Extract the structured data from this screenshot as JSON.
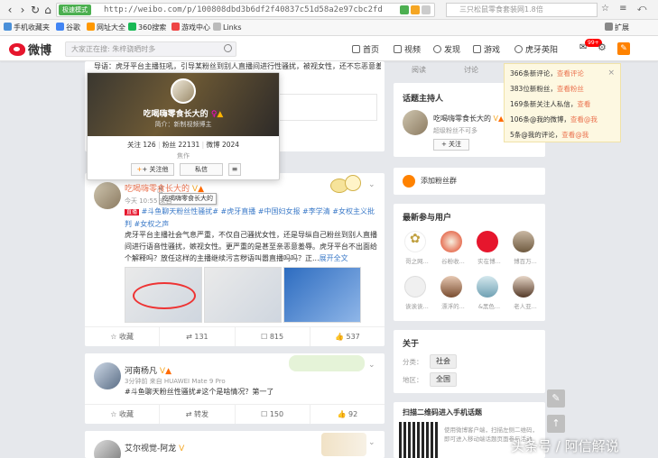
{
  "browser": {
    "mode_badge": "极速模式",
    "url": "http://weibo.com/p/100808dbd3b6df2f40837c51d58a2e97cbc2fd?k=斗鱼聊天粉丝打撒",
    "search_placeholder": "三只松鼠零食套装网1.8倍",
    "bookmarks": [
      "手机收藏夹",
      "谷歌",
      "网址大全",
      "360搜索",
      "游戏中心",
      "Links"
    ],
    "extension_label": "扩展"
  },
  "topbar": {
    "logo": "微博",
    "search_placeholder": "大家正在搜: 朱梓骁晒时多",
    "nav": [
      "首页",
      "视频",
      "发现",
      "游戏",
      "虎牙英阳"
    ],
    "badge": "99+"
  },
  "notice": {
    "lines": [
      {
        "text": "366条新评论，",
        "link": "查看评论"
      },
      {
        "text": "383位新粉丝，",
        "link": "查看粉丝"
      },
      {
        "text": "169条新关注人私信，",
        "link": "查看"
      },
      {
        "text": "106条@我的微博，",
        "link": "查看@我"
      },
      {
        "text": "5条@我的评论，",
        "link": "查看@我"
      }
    ],
    "close": "×"
  },
  "top_post": {
    "text": "导语：虎牙平台主播狂吼，引导某粉丝到别人直播间进行性骚扰，被视女性，还不忘恶意羞辱",
    "actions": [
      "阅读",
      "讨论"
    ]
  },
  "popup": {
    "name": "吃喝嗨零食长大的",
    "intro": "简介：新制视频博主",
    "follow_label": "关注",
    "follow_count": "126",
    "fans_label": "粉丝",
    "fans_count": "22131",
    "weibo_label": "微博",
    "weibo_count": "2024",
    "location": "焦作",
    "follow_btn": "+ 关注他",
    "message_btn": "私信",
    "more_btn": "≡"
  },
  "post1": {
    "author": "吃喝嗨零食长大的",
    "tooltip": "吃喝嗨零食长大的",
    "time": "今天 10:55 来自",
    "tags_line": "#斗鱼聊天粉丝性骚扰# #虎牙直播 #中国妇女报 #李学清 #女权主义批判 #女权之声",
    "text": "虎牙平台主播社会气息严重，不仅自己骚扰女性，还是导纵自己粉丝到别人直播间进行语音性骚扰，嫉视女性。更严重的是甚至亲恶意羞辱。虎牙平台不出面给个解释吗？放任这样的主播继续污言秽语叫嚣直播吗吗？正...",
    "expand": "展开全文",
    "actions": [
      "收藏",
      "131",
      "815",
      "537"
    ]
  },
  "post2": {
    "author": "河南杨凡",
    "meta": "3分钟前 来自 HUAWEI Mate 9 Pro",
    "text": "#斗鱼聊天粉丝性骚扰#这个是啥情况？第一了",
    "actions": [
      "收藏",
      "转发",
      "150",
      "92"
    ]
  },
  "post3": {
    "author": "艾尔视觉-阿龙"
  },
  "host": {
    "title": "话题主持人",
    "name": "吃喝嗨零食长大的",
    "desc": "超级粉丝不可多",
    "follow_btn": "+ 关注"
  },
  "join_fans": "添加粉丝群",
  "recent_users": {
    "title": "最新参与用户",
    "users": [
      "哥之网...",
      "谷粉收...",
      "实在博...",
      "博百万...",
      "诶诶诶...",
      "漂浮的...",
      "&黑色...",
      "老人亚..."
    ]
  },
  "about": {
    "title": "关于",
    "category_label": "分类：",
    "category": "社会",
    "region_label": "地区：",
    "region": "全国"
  },
  "qr_block": {
    "title": "扫描二维码进入手机话题",
    "desc": "使用微博客户端，扫描左侧二维码，即可进入移动端话题页面参与活动"
  },
  "watermark": "头条号 / 阿信解说",
  "colors": {
    "accent": "#ff8200",
    "weibo_red": "#e6162d",
    "link": "#eb7350",
    "topic_blue": "#3b7ac8"
  }
}
